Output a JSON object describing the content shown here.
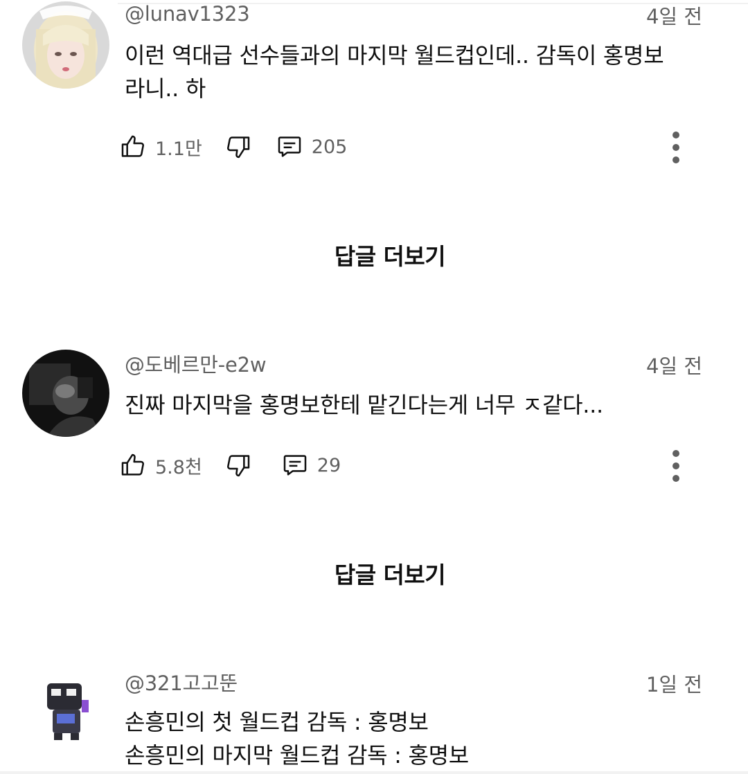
{
  "comments": [
    {
      "author": "@lunav1323",
      "time": "4일 전",
      "lines": [
        "이런 역대급 선수들과의 마지막 월드컵인데.. 감독이 홍명보",
        "라니.. 하"
      ],
      "likes": "1.1만",
      "replies": "205",
      "avatar_icon": "blonde-girl-avatar"
    },
    {
      "author": "@도베르만-e2w",
      "time": "4일 전",
      "lines": [
        "진짜 마지막을 홍명보한테 맡긴다는게 너무 ㅈ같다..."
      ],
      "likes": "5.8천",
      "replies": "29",
      "avatar_icon": "dark-photo-avatar"
    },
    {
      "author": "@321고고뚠",
      "time": "1일 전",
      "lines": [
        "손흥민의 첫 월드컵 감독 : 홍명보",
        "손흥민의 마지막 월드컵 감독 : 홍명보"
      ],
      "avatar_icon": "character-avatar"
    }
  ],
  "view_replies_label": "답글 더보기",
  "icons": {
    "like": "thumbs-up-icon",
    "dislike": "thumbs-down-icon",
    "reply": "comment-icon",
    "more": "more-vert-icon"
  },
  "colors": {
    "text": "#0f0f0f",
    "secondary": "#606060",
    "background": "#ffffff"
  }
}
